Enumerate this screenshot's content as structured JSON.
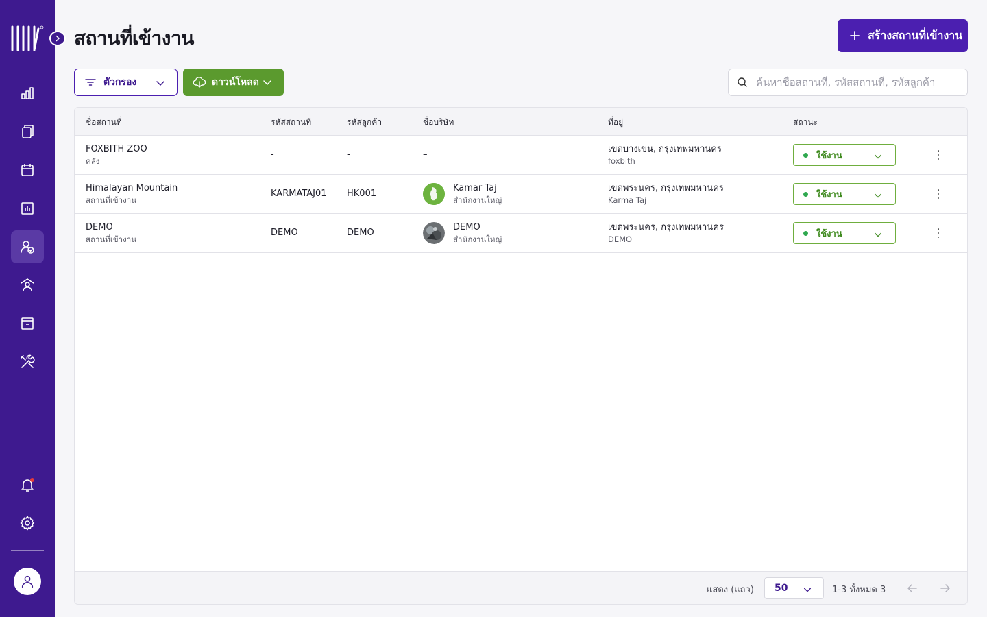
{
  "page": {
    "title": "สถานที่เข้างาน"
  },
  "header": {
    "create_button": "สร้างสถานที่เข้างาน"
  },
  "toolbar": {
    "filter_label": "ตัวกรอง",
    "download_label": "ดาวน์โหลด",
    "search_placeholder": "ค้นหาชื่อสถานที่, รหัสสถานที่, รหัสลูกค้า"
  },
  "table": {
    "columns": [
      "ชื่อสถานที่",
      "รหัสสถานที่",
      "รหัสลูกค้า",
      "ชื่อบริษัท",
      "ที่อยู่",
      "สถานะ"
    ],
    "rows": [
      {
        "name": "FOXBITH ZOO",
        "type": "คลัง",
        "location_code": "-",
        "customer_code": "-",
        "company": "–",
        "company_branch": "",
        "address": "เขตบางเขน, กรุงเทพมหานคร",
        "address_sub": "foxbith",
        "status": "ใช้งาน"
      },
      {
        "name": "Himalayan Mountain",
        "type": "สถานที่เข้างาน",
        "location_code": "KARMATAJ01",
        "customer_code": "HK001",
        "company": "Kamar Taj",
        "company_branch": "สำนักงานใหญ่",
        "address": "เขตพระนคร, กรุงเทพมหานคร",
        "address_sub": "Karma Taj",
        "status": "ใช้งาน"
      },
      {
        "name": "DEMO",
        "type": "สถานที่เข้างาน",
        "location_code": "DEMO",
        "customer_code": "DEMO",
        "company": "DEMO",
        "company_branch": "สำนักงานใหญ่",
        "address": "เขตพระนคร, กรุงเทพมหานคร",
        "address_sub": "DEMO",
        "status": "ใช้งาน"
      }
    ]
  },
  "footer": {
    "rows_label": "แสดง (แถว)",
    "rows_per_page": "50",
    "range_text": "1-3 ทั้งหมด 3"
  },
  "colors": {
    "sidebar": "#3e1a8f",
    "primary": "#4b1fb0",
    "download": "#5b9a2e",
    "status_active": "#3f8a1f"
  },
  "icons": {
    "sidebar": [
      "dashboard-icon",
      "documents-icon",
      "calendar-icon",
      "report-icon",
      "user-check-icon",
      "location-user-icon",
      "archive-icon",
      "tools-icon",
      "bell-icon",
      "gear-icon",
      "user-icon"
    ]
  }
}
